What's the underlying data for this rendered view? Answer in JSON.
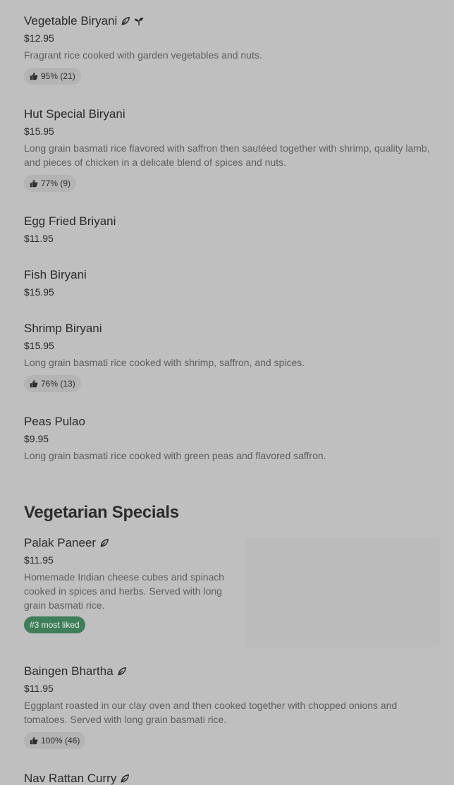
{
  "items_group_1": [
    {
      "name": "Vegetable Biryani",
      "price": "$12.95",
      "desc": "Fragrant rice cooked with garden vegetables and nuts.",
      "rating": "95% (21)"
    },
    {
      "name": "Hut Special Biryani",
      "price": "$15.95",
      "desc": "Long grain basmati rice flavored with saffron then sautéed together with shrimp, quality lamb, and pieces of chicken in a delicate blend of spices and nuts.",
      "rating": "77% (9)"
    },
    {
      "name": "Egg Fried Briyani",
      "price": "$11.95"
    },
    {
      "name": "Fish Biryani",
      "price": "$15.95"
    },
    {
      "name": "Shrimp Biryani",
      "price": "$15.95",
      "desc": "Long grain basmati rice cooked with shrimp, saffron, and spices.",
      "rating": "76% (13)"
    },
    {
      "name": "Peas Pulao",
      "price": "$9.95",
      "desc": "Long grain basmati rice cooked with green peas and flavored saffron."
    }
  ],
  "section": {
    "title": "Vegetarian Specials"
  },
  "items_group_2": [
    {
      "name": "Palak Paneer",
      "price": "$11.95",
      "desc": "Homemade Indian cheese cubes and spinach cooked in spices and herbs. Served with long grain basmati rice.",
      "badge": "#3 most liked"
    },
    {
      "name": "Baingen Bhartha",
      "price": "$11.95",
      "desc": "Eggplant roasted in our clay oven and then cooked together with chopped onions and tomatoes. Served with long grain basmati rice.",
      "rating": "100% (46)"
    },
    {
      "name": "Nav Rattan Curry"
    }
  ],
  "icons": {
    "vegetarian": "leaf-icon",
    "vegan": "sprout-icon",
    "rating": "thumbs-up-icon"
  },
  "colors": {
    "background": "#bfbfbf",
    "badge": "#3f7e58",
    "pill": "#b4b4b4"
  }
}
